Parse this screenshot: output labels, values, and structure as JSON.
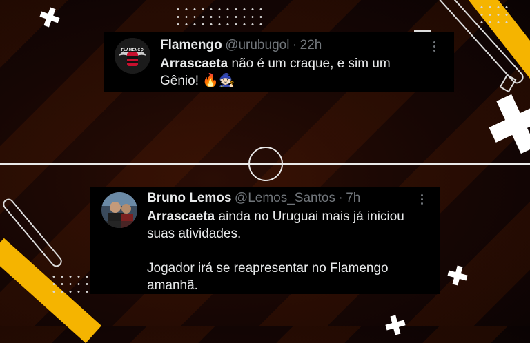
{
  "tweets": [
    {
      "author_name": "Flamengo",
      "handle": "@urubugol",
      "separator": "·",
      "time": "22h",
      "mention": "Arrascaeta",
      "text_line1": " não é um craque, e sim um",
      "text_line2": "Gênio! 🔥🧙🏻",
      "avatar_text": "FLAMENGO"
    },
    {
      "author_name": "Bruno Lemos",
      "handle": "@Lemos_Santos",
      "separator": "·",
      "time": "7h",
      "mention": "Arrascaeta",
      "text_line1": " ainda no Uruguai mais já iniciou",
      "text_line2": "suas atividades.",
      "text_line3": "Jogador irá se reapresentar no Flamengo",
      "text_line4": "amanhã."
    }
  ],
  "colors": {
    "accent_yellow": "#f5b400",
    "background": "#160604",
    "text": "#e7e9ea",
    "muted": "#71767b"
  }
}
